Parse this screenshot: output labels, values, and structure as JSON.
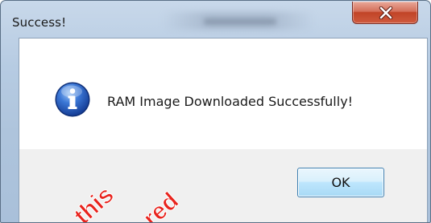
{
  "window": {
    "title": "Success!"
  },
  "dialog": {
    "message": "RAM Image Downloaded Successfully!",
    "ok_label": "OK",
    "icon": "info-icon"
  },
  "watermark": {
    "words": [
      "this",
      "red"
    ],
    "color": "#e8221c"
  },
  "colors": {
    "close_button": "#c8452a",
    "ok_button_border": "#3c7fb1",
    "info_icon": "#1f55b3"
  }
}
